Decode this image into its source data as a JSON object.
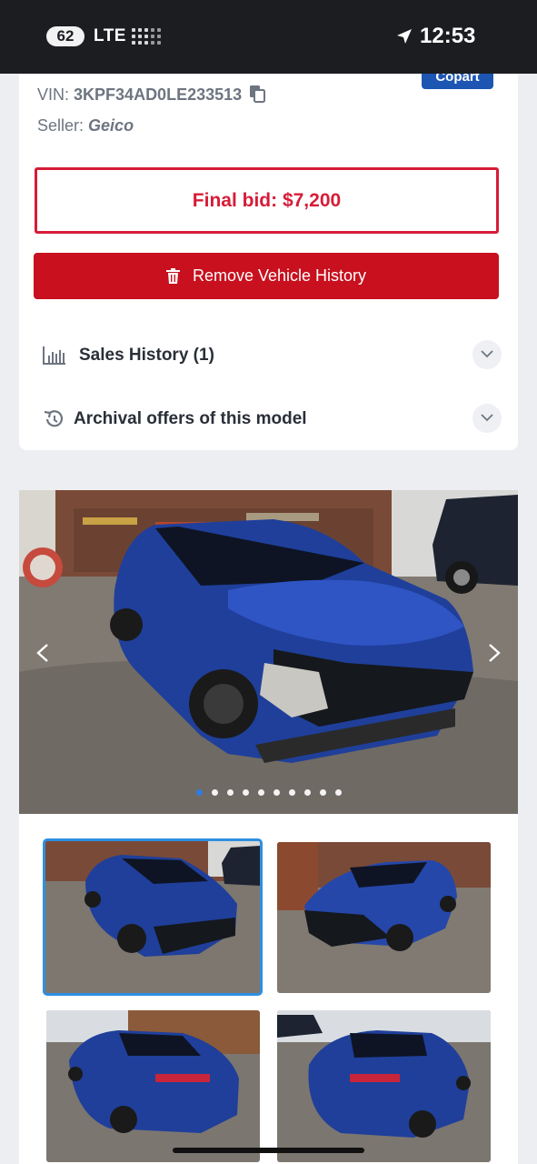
{
  "status_bar": {
    "signal_badge": "62",
    "network": "LTE",
    "time": "12:53",
    "icons": [
      "cellular-dots-icon",
      "location-arrow-icon"
    ]
  },
  "vehicle": {
    "site_badge": "Copart",
    "vin_label": "VIN:",
    "vin_value": "3KPF34AD0LE233513",
    "seller_label": "Seller:",
    "seller_value": "Geico"
  },
  "final_bid": {
    "label": "Final bid: $7,200"
  },
  "actions": {
    "remove_history": "Remove Vehicle History"
  },
  "accordions": {
    "sales_history": "Sales History (1)",
    "archival_offers": "Archival offers of this model"
  },
  "gallery": {
    "total_images": 10,
    "active_index": 0,
    "colors": {
      "accent": "#2b7de9",
      "brand_red": "#c8101e",
      "bid_red": "#d61c38",
      "badge_blue": "#1d55b3"
    }
  }
}
